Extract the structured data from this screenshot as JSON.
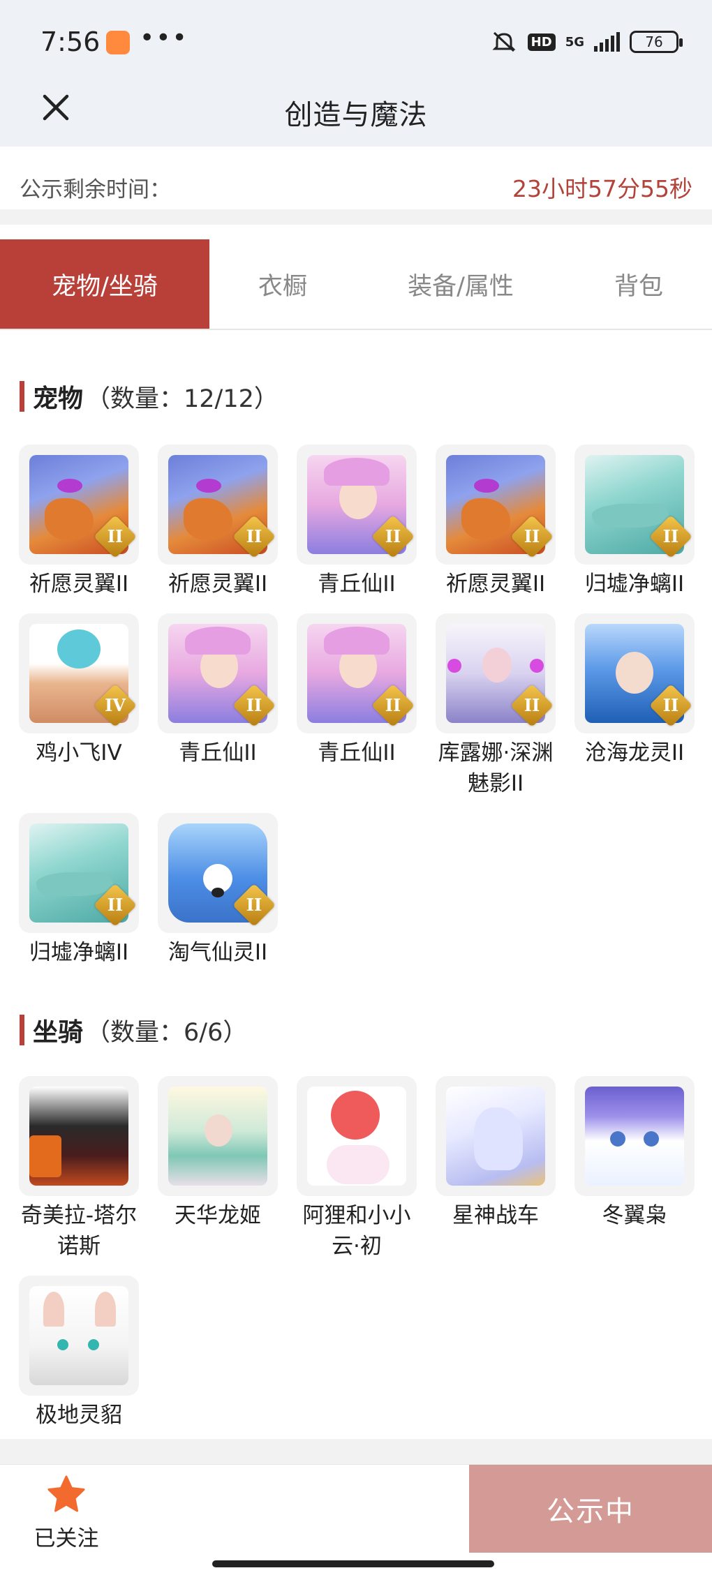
{
  "status_bar": {
    "time": "7:56",
    "more": "•••",
    "hd": "HD",
    "network": "5G",
    "battery": "76"
  },
  "nav": {
    "title": "创造与魔法"
  },
  "timer": {
    "label": "公示剩余时间：",
    "value": "23小时57分55秒"
  },
  "tabs": [
    {
      "label": "宠物/坐骑",
      "active": true
    },
    {
      "label": "衣橱",
      "active": false
    },
    {
      "label": "装备/属性",
      "active": false
    },
    {
      "label": "背包",
      "active": false
    }
  ],
  "pets": {
    "title": "宠物",
    "count": "（数量：12/12）",
    "items": [
      {
        "label": "祈愿灵翼II",
        "badge": "II",
        "icon": "griffin-art"
      },
      {
        "label": "祈愿灵翼II",
        "badge": "II",
        "icon": "griffin-art"
      },
      {
        "label": "青丘仙II",
        "badge": "II",
        "icon": "fox-fairy-art"
      },
      {
        "label": "祈愿灵翼II",
        "badge": "II",
        "icon": "griffin-art"
      },
      {
        "label": "归墟净螭II",
        "badge": "II",
        "icon": "jade-dragon-art"
      },
      {
        "label": "鸡小飞IV",
        "badge": "IV",
        "icon": "chick-art"
      },
      {
        "label": "青丘仙II",
        "badge": "II",
        "icon": "fox-fairy-art"
      },
      {
        "label": "青丘仙II",
        "badge": "II",
        "icon": "fox-fairy-art"
      },
      {
        "label": "库露娜·深渊魅影II",
        "badge": "II",
        "icon": "kurna-art"
      },
      {
        "label": "沧海龙灵II",
        "badge": "II",
        "icon": "sea-dragon-art"
      },
      {
        "label": "归墟净螭II",
        "badge": "II",
        "icon": "jade-dragon-art"
      },
      {
        "label": "淘气仙灵II",
        "badge": "II",
        "icon": "sprite-art"
      }
    ]
  },
  "mounts": {
    "title": "坐骑",
    "count": "（数量：6/6）",
    "items": [
      {
        "label": "奇美拉-塔尔诺斯",
        "icon": "chimera-art"
      },
      {
        "label": "天华龙姬",
        "icon": "dragon-princess-art"
      },
      {
        "label": "阿狸和小小云·初",
        "icon": "ali-cloud-art"
      },
      {
        "label": "星神战车",
        "icon": "star-chariot-art"
      },
      {
        "label": "冬翼枭",
        "icon": "winter-owl-art"
      },
      {
        "label": "极地灵貂",
        "icon": "polar-ferret-art"
      }
    ]
  },
  "bottom": {
    "follow_label": "已关注",
    "publish_label": "公示中"
  },
  "colors": {
    "accent": "#b94039",
    "timer": "#b2433b",
    "publish_button": "#d49a96",
    "star": "#f26a2e"
  }
}
